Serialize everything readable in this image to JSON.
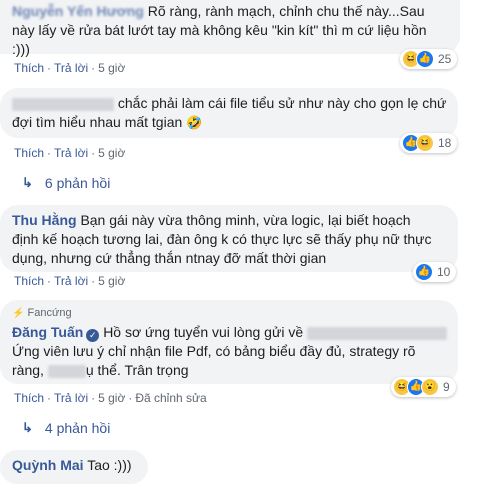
{
  "comments": [
    {
      "name": "Nguyễn Yến Hương",
      "text_line1": "Rõ ràng, rành mạch, chỉnh chu thế này...Sau",
      "text_line2": "này lấy về rửa bát lướt tay mà không kêu \"kin kít\" thì m cứ liệu hồn",
      "text_line3": ":)))",
      "like": "Thích",
      "reply": "Trả lời",
      "time": "5 giờ",
      "reaction_count": "25",
      "reactions": [
        "haha-icon",
        "like-icon"
      ]
    },
    {
      "text_line1": "chắc phải làm cái file tiểu sử như này cho gọn lẹ chứ",
      "text_line2": "đợi tìm hiểu nhau mất tgian",
      "like": "Thích",
      "reply": "Trả lời",
      "time": "5 giờ",
      "reaction_count": "18",
      "reactions": [
        "like-icon",
        "haha-icon"
      ],
      "replies": "6 phản hồi"
    },
    {
      "name": "Thu Hằng",
      "text_line1": "Bạn gái này vừa thông minh, vừa logic, lại biết hoạch",
      "text_line2": "định kế hoạch tương lai, đàn ông k có thực lực sẽ thấy phụ nữ thực",
      "text_line3": "dụng, nhưng cứ thẳng thắn ntnay đỡ mất thời gian",
      "like": "Thích",
      "reply": "Trả lời",
      "time": "5 giờ",
      "reaction_count": "10",
      "reactions": [
        "like-icon"
      ]
    },
    {
      "fan_badge": "Fancứng",
      "name": "Đăng Tuấn",
      "text_line1": "Hồ sơ ứng tuyển vui lòng gửi về",
      "text_line2": "Ứng viên lưu ý chỉ nhận file Pdf, có bảng biểu đầy đủ, strategy rõ",
      "text_line3a": "ràng,",
      "text_line3b": "ụ thể. Trân trọng",
      "like": "Thích",
      "reply": "Trả lời",
      "time": "5 giờ",
      "edited": "Đã chỉnh sửa",
      "reaction_count": "9",
      "reactions": [
        "haha-icon",
        "like-icon",
        "wow-icon"
      ],
      "replies": "4 phản hồi"
    },
    {
      "name": "Quỳnh Mai",
      "text_line1": "Tao :)))"
    }
  ],
  "colors": {
    "name_link": "#385898",
    "bubble_bg": "#f2f3f5",
    "meta_text": "#606770",
    "like_blue": "#1877f2",
    "haha_yellow": "#f7c744"
  }
}
